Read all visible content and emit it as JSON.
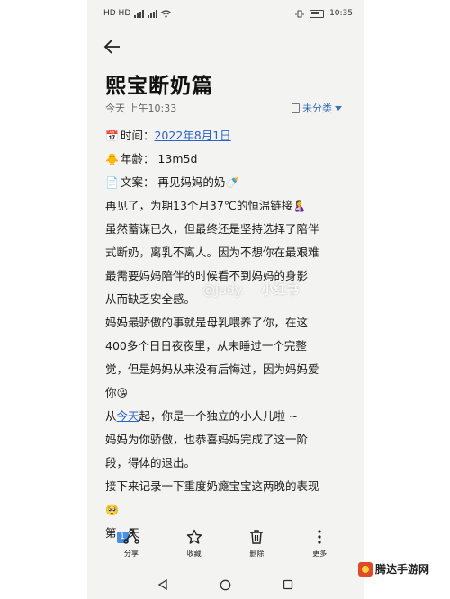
{
  "status_bar": {
    "left": "HD HD",
    "time": "10:35"
  },
  "note": {
    "title": "熙宝断奶篇",
    "meta": "今天 上午10:33",
    "category": "未分类"
  },
  "content": {
    "time_label": "时间：",
    "time_value": "2022年8月1日",
    "age": "年龄： 13m5d",
    "copy": "文案： 再见妈妈的奶",
    "p1_l1": "再见了，为期13个月37℃的恒温链接",
    "p1_l2": "虽然蓄谋已久，但最终还是坚持选择了陪伴",
    "p1_l3": "式断奶，离乳不离人。因为不想你在最艰难",
    "p1_l4": "最需要妈妈陪伴的时候看不到妈妈的身影",
    "p1_l5": "从而缺乏安全感。",
    "p2_l1": "妈妈最骄傲的事就是母乳喂养了你，在这",
    "p2_l2": "400多个日日夜夜里，从未睡过一个完整",
    "p2_l3": "觉，但是妈妈从来没有后悔过，因为妈妈爱",
    "p2_l4": "你",
    "p3_pre": "从",
    "p3_link": "今天",
    "p3_post": "起，你是一个独立的小人儿啦 ~",
    "p4_l1": "妈妈为你骄傲，也恭喜妈妈完成了这一阶",
    "p4_l2": "段，得体的退出。",
    "p5_l1": "接下来记录一下重度奶瘾宝宝这两晚的表现",
    "day_pre": "第",
    "day_num": "1",
    "day_post": "天"
  },
  "watermark": {
    "handle": "@Judy.",
    "brand": "小红书"
  },
  "toolbar": {
    "share": "分享",
    "favorite": "收藏",
    "delete": "删除",
    "more": "更多"
  },
  "logo": {
    "text": "腾达手游网"
  }
}
